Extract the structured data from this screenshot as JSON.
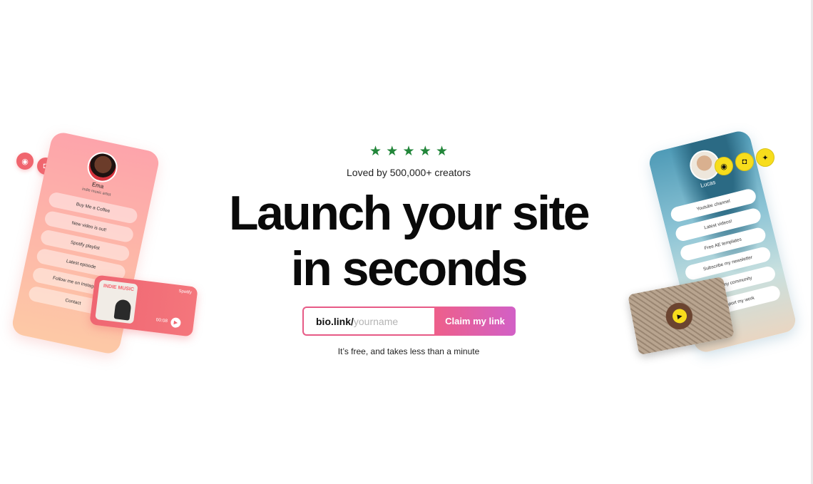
{
  "hero": {
    "stars": [
      "★",
      "★",
      "★",
      "★",
      "★"
    ],
    "tagline": "Loved by 500,000+ creators",
    "headline_line1": "Launch your site",
    "headline_line2": "in seconds",
    "url_prefix": "bio.link/",
    "url_placeholder": "yourname",
    "url_value": "",
    "claim_button": "Claim my link",
    "note": "It’s free, and takes less than a minute"
  },
  "left_mockup": {
    "profile_name": "Ema",
    "profile_subtitle": "indie music artist",
    "links": [
      "Buy Me a Coffee",
      "New video is out!",
      "Spotify playlist",
      "Latest episode",
      "Follow me on Instagram",
      "Contact"
    ],
    "social_icons": [
      "spotify-icon",
      "instagram-icon",
      "twitter-icon"
    ],
    "player": {
      "album_title": "INDIE MUSIC",
      "service": "Spotify",
      "time": "00:08"
    }
  },
  "right_mockup": {
    "profile_name": "Lucas",
    "links": [
      "Youtube channel",
      "Latest videos!",
      "Free AE templates",
      "Subscribe my newsletter",
      "Join my community",
      "Support my work"
    ],
    "social_icons": [
      "spotify-icon",
      "instagram-icon",
      "twitter-icon"
    ]
  },
  "colors": {
    "accent_pink": "#e75a86",
    "button_gradient_start": "#ee5f8a",
    "button_gradient_end": "#d260c6",
    "star_green": "#22863a",
    "social_yellow": "#f7dd1c",
    "social_coral": "#f0656e"
  }
}
